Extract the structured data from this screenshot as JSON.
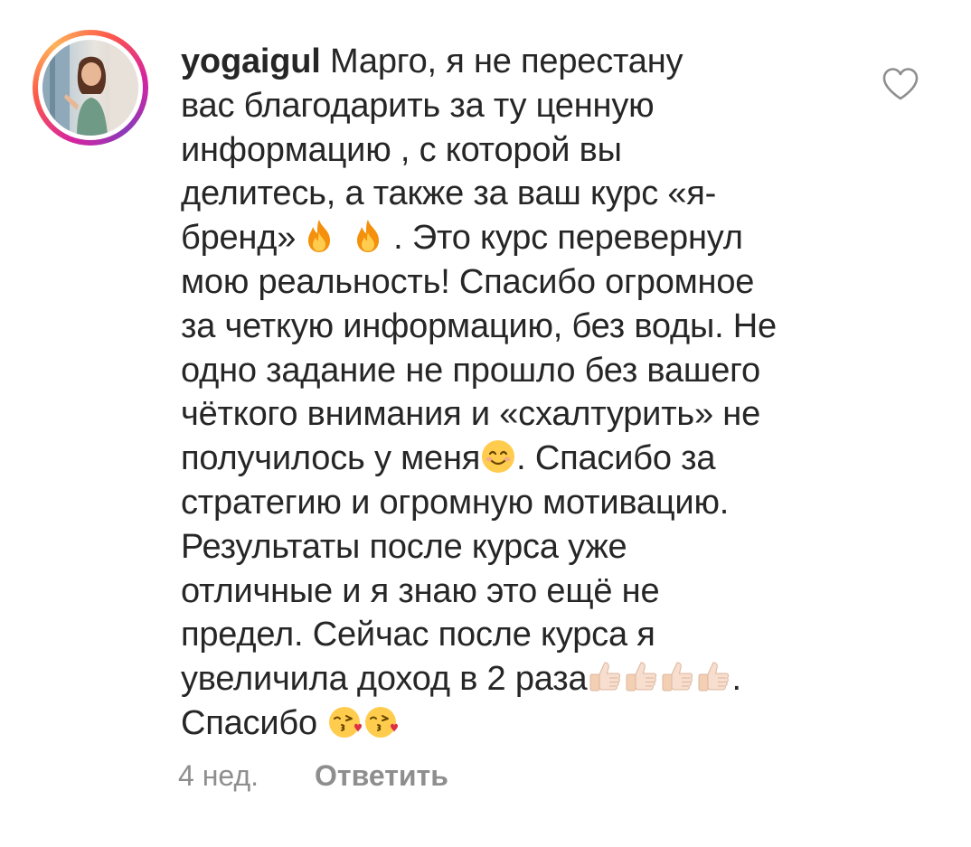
{
  "comment": {
    "username": "yogaigul",
    "lines": [
      "Марго, я не перестану",
      "вас благодарить за ту ценную",
      "информацию , с которой вы",
      "делитесь, а также за ваш курс «я-",
      "бренд»",
      ". Это курс перевернул",
      "мою реальность! Спасибо огромное",
      "за четкую информацию, без воды. Не",
      "одно задание не прошло без вашего",
      "чёткого внимания и «схалтурить» не",
      "получилось у меня",
      ". Спасибо за",
      "стратегию и огромную мотивацию.",
      "Результаты после курса уже",
      "отличные и я знаю это ещё не",
      "предел. Сейчас после курса я",
      "увеличила доход в 2 раза",
      ".",
      "Спасибо"
    ],
    "emojis": {
      "fire": "fire-emoji",
      "smile": "smiling-face-emoji",
      "thumbs": "thumbs-up-emoji",
      "kiss": "face-blowing-kiss-emoji"
    },
    "like_icon": "heart-outline-icon",
    "time": "4 нед.",
    "reply_label": "Ответить",
    "colors": {
      "text": "#262626",
      "meta": "#8e8e8e",
      "story_ring": [
        "#fdb35a",
        "#fd5949",
        "#d6249f"
      ]
    }
  }
}
